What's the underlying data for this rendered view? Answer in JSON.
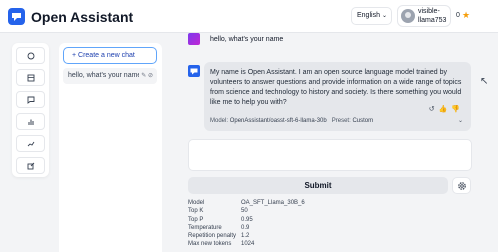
{
  "app": {
    "title": "Open Assistant"
  },
  "header": {
    "language": "English",
    "username": "visible-llama753",
    "score": "0"
  },
  "sidebar": {
    "buttons": [
      "chat",
      "dashboard",
      "messages",
      "stats",
      "leaderboard",
      "external-link"
    ]
  },
  "chats": {
    "new_chat_label": "+ Create a new chat",
    "items": [
      {
        "title": "hello, what's your name"
      }
    ]
  },
  "conversation": {
    "user_message": "hello, what's your name",
    "bot_message": "My name is Open Assistant. I am an open source language model trained by volunteers to answer questions and provide information on a wide range of topics from science and technology to history and society. Is there something you would like me to help you with?",
    "model_label": "Model:",
    "model_value": "OpenAssistant/oasst-sft-6-llama-30b",
    "preset_label": "Preset:",
    "preset_value": "Custom"
  },
  "composer": {
    "placeholder": "",
    "submit_label": "Submit"
  },
  "parameters": [
    {
      "key": "Model",
      "value": "OA_SFT_Llama_30B_6"
    },
    {
      "key": "Top K",
      "value": "50"
    },
    {
      "key": "Top P",
      "value": "0.95"
    },
    {
      "key": "Temperature",
      "value": "0.9"
    },
    {
      "key": "Repetition penalty",
      "value": "1.2"
    },
    {
      "key": "Max new tokens",
      "value": "1024"
    }
  ],
  "colors": {
    "accent": "#2563eb",
    "star": "#f59e0b"
  }
}
